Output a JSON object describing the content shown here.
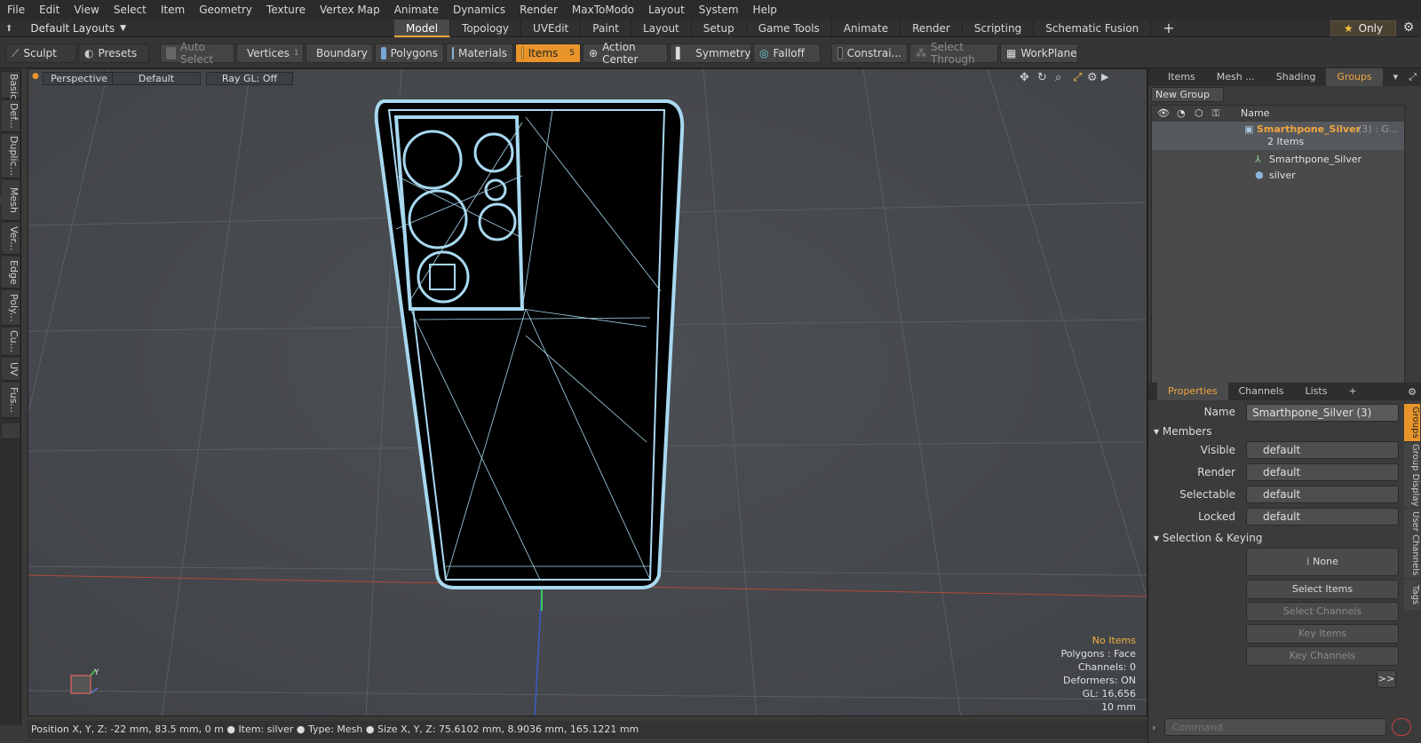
{
  "menu": [
    "File",
    "Edit",
    "View",
    "Select",
    "Item",
    "Geometry",
    "Texture",
    "Vertex Map",
    "Animate",
    "Dynamics",
    "Render",
    "MaxToModo",
    "Layout",
    "System",
    "Help"
  ],
  "layout_selector": "Default Layouts",
  "tabs": [
    "Model",
    "Topology",
    "UVEdit",
    "Paint",
    "Layout",
    "Setup",
    "Game Tools",
    "Animate",
    "Render",
    "Scripting",
    "Schematic Fusion"
  ],
  "active_tab": "Model",
  "only_label": "Only",
  "toolbar": {
    "sculpt": "Sculpt",
    "presets": "Presets",
    "auto_select": "Auto Select",
    "vertices": "Vertices",
    "vertices_count": "1",
    "boundary": "Boundary",
    "polygons": "Polygons",
    "materials": "Materials",
    "items": "Items",
    "items_count": "5",
    "action_center": "Action Center",
    "symmetry": "Symmetry",
    "falloff": "Falloff",
    "constraints": "Constrai...",
    "select_through": "Select Through",
    "workplane": "WorkPlane"
  },
  "left_tabs": [
    "Basic",
    "Def...",
    "Duplic...",
    "Mesh ...",
    "Ver...",
    "Edge",
    "Poly...",
    "Cu...",
    "UV",
    "Fus..."
  ],
  "viewport": {
    "view": "Perspective",
    "shading": "Default",
    "raygl": "Ray GL: Off"
  },
  "vp_info": {
    "no_items": "No Items",
    "polygons": "Polygons : Face",
    "channels": "Channels: 0",
    "deformers": "Deformers: ON",
    "gl": "GL: 16,656",
    "scale": "10 mm"
  },
  "status": {
    "position": "Position X, Y, Z:  -22 mm, 83.5 mm, 0 m",
    "item": "Item:  silver",
    "type": "Type:  Mesh",
    "size": "Size X, Y, Z:   75.6102 mm, 8.9036 mm, 165.1221 mm"
  },
  "top_tabs": [
    "Items",
    "Mesh ...",
    "Shading",
    "Groups"
  ],
  "active_top_tab": "Groups",
  "new_group": "New Group",
  "list_header": "Name",
  "group": {
    "name": "Smarthpone_Silver",
    "suffix": "(3) : G...",
    "count": "2 Items",
    "children": [
      "Smarthpone_Silver",
      "silver"
    ]
  },
  "bottom_tabs": [
    "Properties",
    "Channels",
    "Lists"
  ],
  "active_bottom_tab": "Properties",
  "props": {
    "name_label": "Name",
    "name_value": "Smarthpone_Silver (3)",
    "members": "Members",
    "visible": "Visible",
    "render": "Render",
    "selectable": "Selectable",
    "locked": "Locked",
    "dd_value": "default",
    "sel_keying": "Selection & Keying",
    "none": "None",
    "select_items": "Select Items",
    "select_channels": "Select Channels",
    "key_items": "Key Items",
    "key_channels": "Key Channels",
    "more": ">>"
  },
  "side_tabs": [
    "Groups",
    "Group Display",
    "User Channels",
    "Tags"
  ],
  "command_placeholder": "Command",
  "colors": {
    "accent": "#e8942a",
    "wire": "#a8d8f0"
  }
}
